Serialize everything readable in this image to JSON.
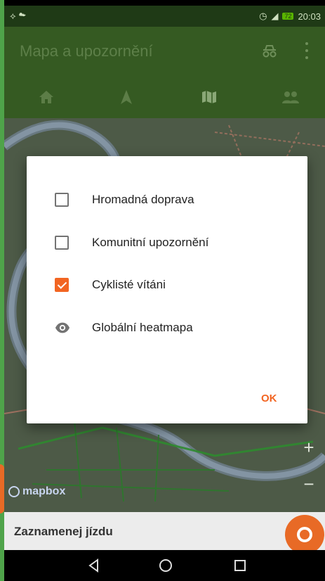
{
  "status_bar": {
    "left_icons": [
      "usb-icon",
      "cloud-icon"
    ],
    "time": "20:03",
    "battery": "72"
  },
  "app_bar": {
    "title": "Mapa a upozornění"
  },
  "tabs": [
    {
      "icon": "home-icon"
    },
    {
      "icon": "route-icon"
    },
    {
      "icon": "map-icon"
    },
    {
      "icon": "community-icon"
    }
  ],
  "dialog": {
    "options": [
      {
        "label": "Hromadná doprava",
        "checked": false
      },
      {
        "label": "Komunitní upozornění",
        "checked": false
      },
      {
        "label": "Cyklisté vítáni",
        "checked": true
      },
      {
        "label": "Globální heatmapa",
        "icon": "eye-icon"
      }
    ],
    "ok_label": "OK"
  },
  "map": {
    "attribution": "mapbox",
    "zoom_in": "+",
    "zoom_out": "−"
  },
  "bottom_bar": {
    "label": "Zaznamenej jízdu"
  },
  "colors": {
    "accent": "#f26522",
    "app_bar": "#355a22",
    "status_bar": "#1f3a16"
  }
}
